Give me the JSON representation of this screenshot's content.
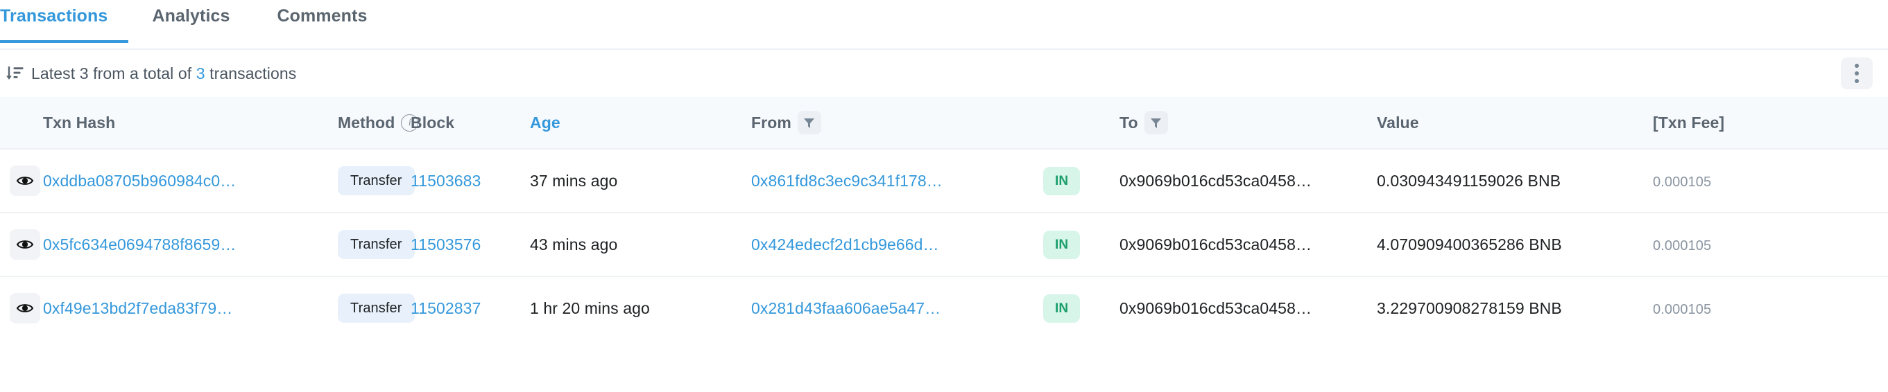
{
  "tabs": [
    {
      "label": "Transactions",
      "active": true
    },
    {
      "label": "Analytics",
      "active": false
    },
    {
      "label": "Comments",
      "active": false
    }
  ],
  "toolbar": {
    "sort_icon": "sort-descending-icon",
    "text_prefix": "Latest 3 from a total of ",
    "total_count": "3",
    "text_suffix": " transactions",
    "menu_icon": "kebab-menu-icon"
  },
  "table": {
    "columns": [
      {
        "key": "eye",
        "label": ""
      },
      {
        "key": "hash",
        "label": "Txn Hash"
      },
      {
        "key": "method",
        "label": "Method",
        "info": true
      },
      {
        "key": "block",
        "label": "Block"
      },
      {
        "key": "age",
        "label": "Age",
        "sorted": true
      },
      {
        "key": "from",
        "label": "From",
        "filter": true
      },
      {
        "key": "dir",
        "label": ""
      },
      {
        "key": "to",
        "label": "To",
        "filter": true
      },
      {
        "key": "value",
        "label": "Value"
      },
      {
        "key": "fee",
        "label": "[Txn Fee]"
      }
    ],
    "rows": [
      {
        "hash": "0xddba08705b960984c0…",
        "method": "Transfer",
        "block": "11503683",
        "age": "37 mins ago",
        "from": "0x861fd8c3ec9c341f178…",
        "direction": "IN",
        "to": "0x9069b016cd53ca0458…",
        "value": "0.030943491159026 BNB",
        "fee": "0.000105"
      },
      {
        "hash": "0x5fc634e0694788f8659…",
        "method": "Transfer",
        "block": "11503576",
        "age": "43 mins ago",
        "from": "0x424edecf2d1cb9e66d…",
        "direction": "IN",
        "to": "0x9069b016cd53ca0458…",
        "value": "4.070909400365286 BNB",
        "fee": "0.000105"
      },
      {
        "hash": "0xf49e13bd2f7eda83f79…",
        "method": "Transfer",
        "block": "11502837",
        "age": "1 hr 20 mins ago",
        "from": "0x281d43faa606ae5a47…",
        "direction": "IN",
        "to": "0x9069b016cd53ca0458…",
        "value": "3.229700908278159 BNB",
        "fee": "0.000105"
      }
    ]
  },
  "colors": {
    "accent": "#3498db",
    "header_bg": "#f7fafd",
    "method_badge_bg": "#e8f1fb",
    "direction_badge_bg": "#d7f5e9",
    "direction_badge_text": "#1a9e6b",
    "muted_text": "#8a95a1"
  }
}
